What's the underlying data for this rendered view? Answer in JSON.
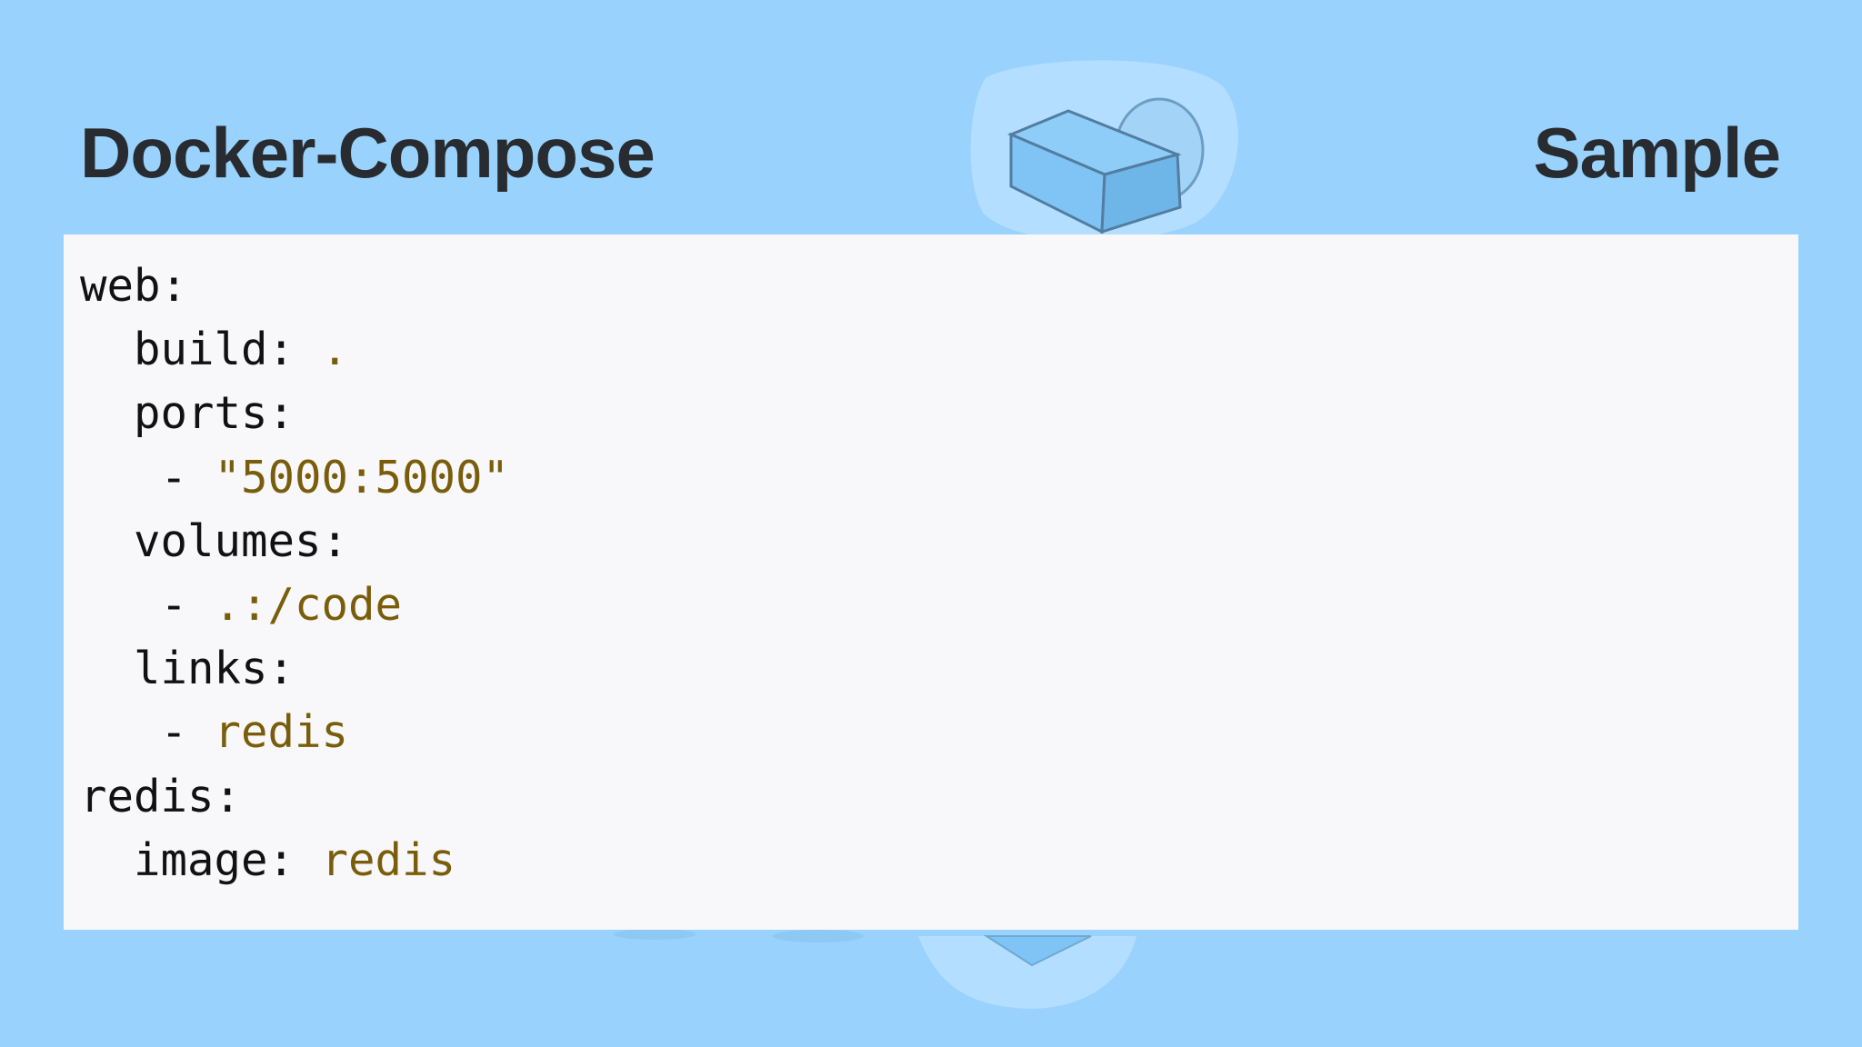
{
  "slide": {
    "title_left": "Docker-Compose",
    "title_right": "Sample",
    "background_color": "#99d3fd",
    "text_color": "#282c31",
    "value_color": "#7a5d0b"
  },
  "code": {
    "lines": [
      {
        "indent": "",
        "key": "web:",
        "value": ""
      },
      {
        "indent": "  ",
        "key": "build: ",
        "value": "."
      },
      {
        "indent": "  ",
        "key": "ports:",
        "value": ""
      },
      {
        "indent": "   ",
        "key": "- ",
        "value": "\"5000:5000\""
      },
      {
        "indent": "  ",
        "key": "volumes:",
        "value": ""
      },
      {
        "indent": "   ",
        "key": "- ",
        "value": ".:/code"
      },
      {
        "indent": "  ",
        "key": "links:",
        "value": ""
      },
      {
        "indent": "   ",
        "key": "- ",
        "value": "redis"
      },
      {
        "indent": "",
        "key": "redis:",
        "value": ""
      },
      {
        "indent": "  ",
        "key": "image: ",
        "value": "redis"
      }
    ]
  },
  "background_art": {
    "icon": "container-box-icon"
  }
}
